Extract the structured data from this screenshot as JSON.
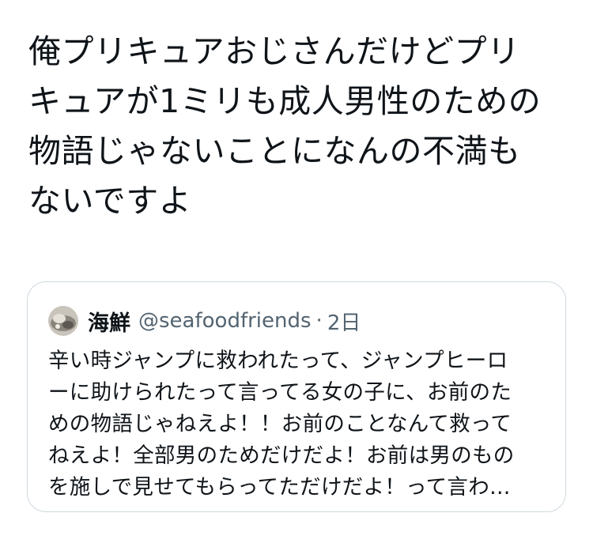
{
  "tweet": {
    "text": "俺プリキュアおじさんだけどプリ\nキュアが1ミリも成人男性のための\n物語じゃないことになんの不満も\nないですよ"
  },
  "quote": {
    "display_name": "海鮮",
    "handle": "@seafoodfriends",
    "separator": "·",
    "time": "2日",
    "text": "辛い時ジャンプに救われたって、ジャンプヒーロ\nーに助けられたって言ってる女の子に、お前のた\nめの物語じゃねえよ！！お前のことなんて救って\nねえよ！全部男のためだけだよ！お前は男のもの\nを施しで見せてもらってただけだよ！って言わ…"
  },
  "colors": {
    "text": "#0f1419",
    "secondary": "#536471",
    "border": "#cfd9de"
  }
}
